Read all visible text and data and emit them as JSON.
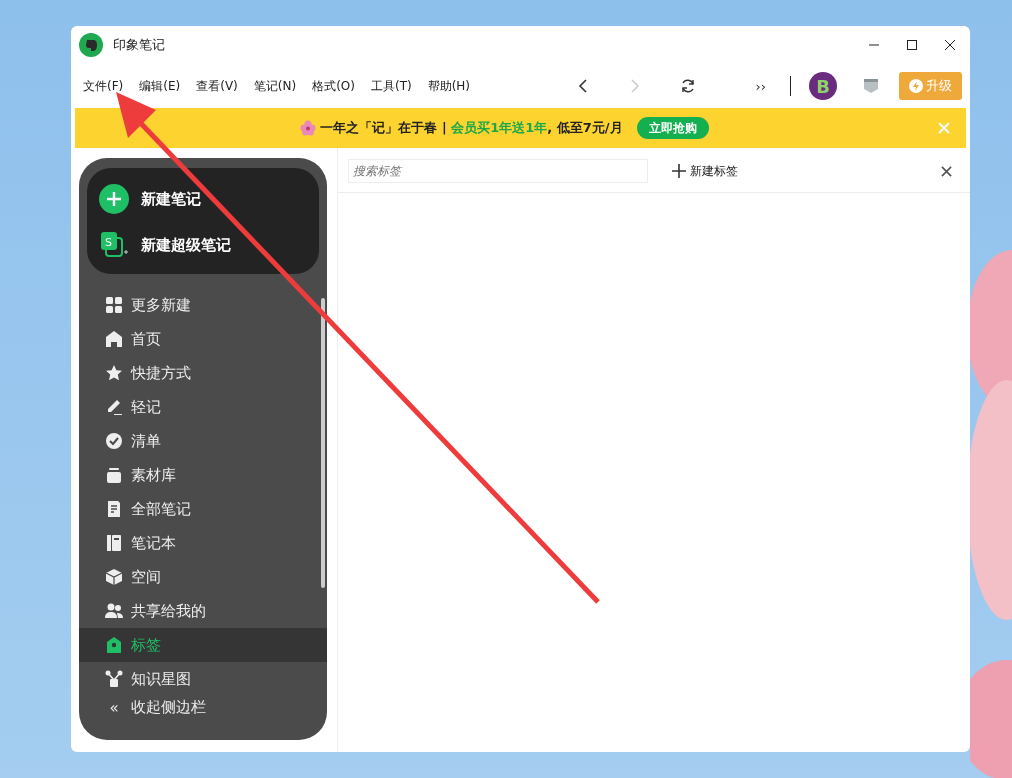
{
  "window": {
    "title": "印象笔记"
  },
  "menu": [
    {
      "label": "文件(F)"
    },
    {
      "label": "编辑(E)"
    },
    {
      "label": "查看(V)"
    },
    {
      "label": "笔记(N)"
    },
    {
      "label": "格式(O)"
    },
    {
      "label": "工具(T)"
    },
    {
      "label": "帮助(H)"
    }
  ],
  "toolbar": {
    "more": "››",
    "avatar_letter": "B",
    "upgrade": "升级"
  },
  "banner": {
    "text": "一年之「记」在于春 | ",
    "highlight": "会员买1年送1年",
    "tail": ", 低至7元/月",
    "button": "立即抢购"
  },
  "sidebar": {
    "create": [
      {
        "kind": "note",
        "label": "新建笔记"
      },
      {
        "kind": "super",
        "label": "新建超级笔记",
        "icon_letter": "S"
      }
    ],
    "items": [
      {
        "kind": "grid",
        "label": "更多新建",
        "selected": false
      },
      {
        "kind": "home",
        "label": "首页",
        "selected": false
      },
      {
        "kind": "star",
        "label": "快捷方式",
        "selected": false
      },
      {
        "kind": "pen",
        "label": "轻记",
        "selected": false
      },
      {
        "kind": "check",
        "label": "清单",
        "selected": false
      },
      {
        "kind": "box",
        "label": "素材库",
        "selected": false
      },
      {
        "kind": "doc",
        "label": "全部笔记",
        "selected": false
      },
      {
        "kind": "book",
        "label": "笔记本",
        "selected": false
      },
      {
        "kind": "cube",
        "label": "空间",
        "selected": false
      },
      {
        "kind": "people",
        "label": "共享给我的",
        "selected": false
      },
      {
        "kind": "tag",
        "label": "标签",
        "selected": true
      },
      {
        "kind": "graph",
        "label": "知识星图",
        "selected": false
      }
    ],
    "collapse": {
      "icon": "«",
      "label": "收起侧边栏"
    }
  },
  "tags_panel": {
    "search": {
      "placeholder": "搜索标签"
    },
    "new_tag": "新建标签"
  }
}
